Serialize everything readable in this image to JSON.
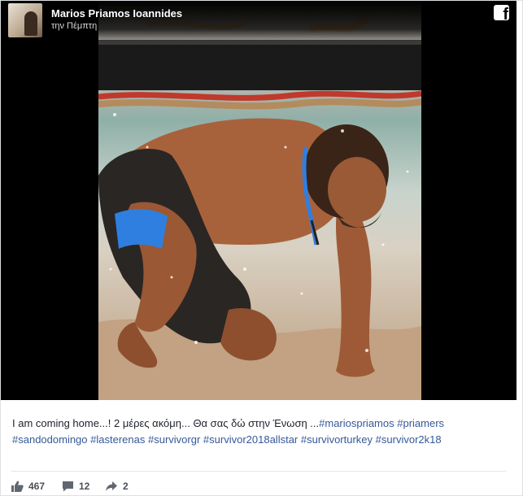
{
  "author": {
    "name": "Marios Priamos Ioannides",
    "time": "την Πέμπτη"
  },
  "icons": {
    "brand": "facebook-icon",
    "like": "like-icon",
    "comment": "comment-icon",
    "share": "share-icon"
  },
  "caption": {
    "text": "I am coming home...! 2 μέρες ακόμη... Θα σας δώ στην Ένωση ...",
    "hashtags": [
      "#mariospriamos",
      "#priamers",
      "#sandodomingo",
      "#lasterenas",
      "#survivorgr",
      "#survivor2018allstar",
      "#survivorturkey",
      "#survivor2k18"
    ]
  },
  "stats": {
    "likes": "467",
    "comments": "12",
    "shares": "2"
  },
  "colors": {
    "link": "#365899",
    "text": "#1d2129",
    "muted": "#606770",
    "armband": "#2f7fe0",
    "media_background": "#000000"
  }
}
